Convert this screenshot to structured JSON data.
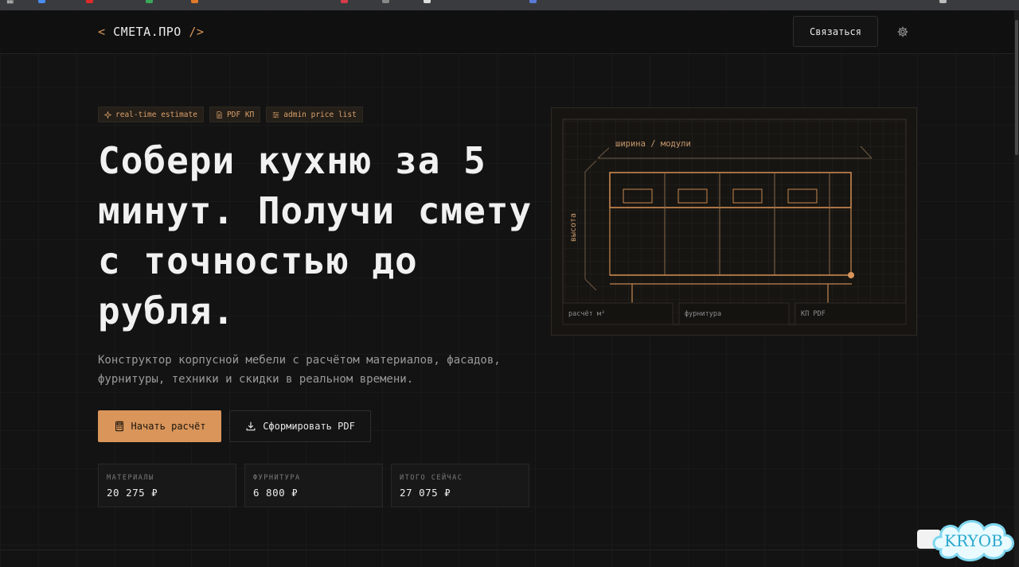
{
  "header": {
    "logo_open": "<",
    "logo_text": "СМЕТА.ПРО",
    "logo_close": "/>",
    "contact_label": "Связаться"
  },
  "icons": {
    "settings": "gear-icon",
    "tag1": "sparkle-icon",
    "tag2": "document-icon",
    "tag3": "list-icon",
    "start": "calculator-icon",
    "pdf": "download-icon"
  },
  "tags": [
    {
      "label": "real-time estimate"
    },
    {
      "label": "PDF КП"
    },
    {
      "label": "admin price list"
    }
  ],
  "hero": {
    "title": "Собери кухню за 5 минут. Получи смету с точностью до рубля.",
    "subtitle": "Конструктор корпусной мебели с расчётом материалов, фасадов, фурнитуры, техники и скидки в реальном времени."
  },
  "actions": {
    "start_label": "Начать расчёт",
    "pdf_label": "Сформировать PDF"
  },
  "stats": [
    {
      "label": "МАТЕРИАЛЫ",
      "value": "20 275 ₽"
    },
    {
      "label": "ФУРНИТУРА",
      "value": "6 800 ₽"
    },
    {
      "label": "ИТОГО СЕЙЧАС",
      "value": "27 075 ₽"
    }
  ],
  "preview": {
    "width_label": "ширина / модули",
    "height_label": "высота",
    "cells": [
      {
        "label": "расчёт м²"
      },
      {
        "label": "фурнитура"
      },
      {
        "label": "КП PDF"
      }
    ]
  },
  "watermark": "KRYOB",
  "colors": {
    "accent": "#d9955a",
    "background": "#131313",
    "text": "#f1f1f1",
    "muted": "#9a9a9a"
  }
}
